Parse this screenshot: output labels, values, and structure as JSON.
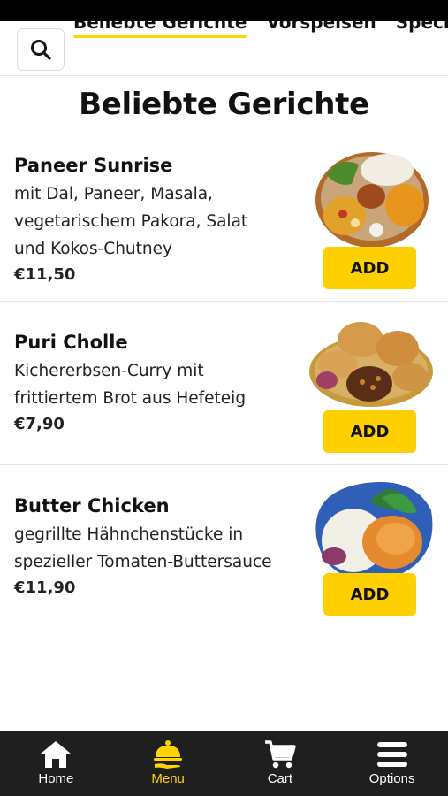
{
  "colors": {
    "accent": "#ffd000",
    "nav_bg": "#1f1f1f",
    "text": "#111111"
  },
  "header": {
    "search_icon": "search-icon",
    "tabs": [
      {
        "label": "Beliebte Gerichte",
        "active": true
      },
      {
        "label": "Vorspeisen",
        "active": false
      },
      {
        "label": "Specials -",
        "active": false
      }
    ]
  },
  "section": {
    "title": "Beliebte Gerichte"
  },
  "dishes": [
    {
      "name": "Paneer Sunrise",
      "description_lines": [
        "mit Dal, Paneer, Masala,",
        "vegetarischem Pakora, Salat",
        "und Kokos-Chutney"
      ],
      "price": "€11,50",
      "add_label": "ADD"
    },
    {
      "name": "Puri Cholle",
      "description_lines": [
        "Kichererbsen-Curry mit",
        "frittiertem Brot aus Hefeteig"
      ],
      "price": "€7,90",
      "add_label": "ADD"
    },
    {
      "name": "Butter Chicken",
      "description_lines": [
        "gegrillte Hähnchenstücke in",
        "spezieller Tomaten-Buttersauce"
      ],
      "price": "€11,90",
      "add_label": "ADD"
    }
  ],
  "bottom_nav": [
    {
      "label": "Home",
      "icon": "home-icon",
      "active": false
    },
    {
      "label": "Menu",
      "icon": "cloche-icon",
      "active": true
    },
    {
      "label": "Cart",
      "icon": "cart-icon",
      "active": false
    },
    {
      "label": "Options",
      "icon": "hamburger-menu-icon",
      "active": false
    }
  ]
}
